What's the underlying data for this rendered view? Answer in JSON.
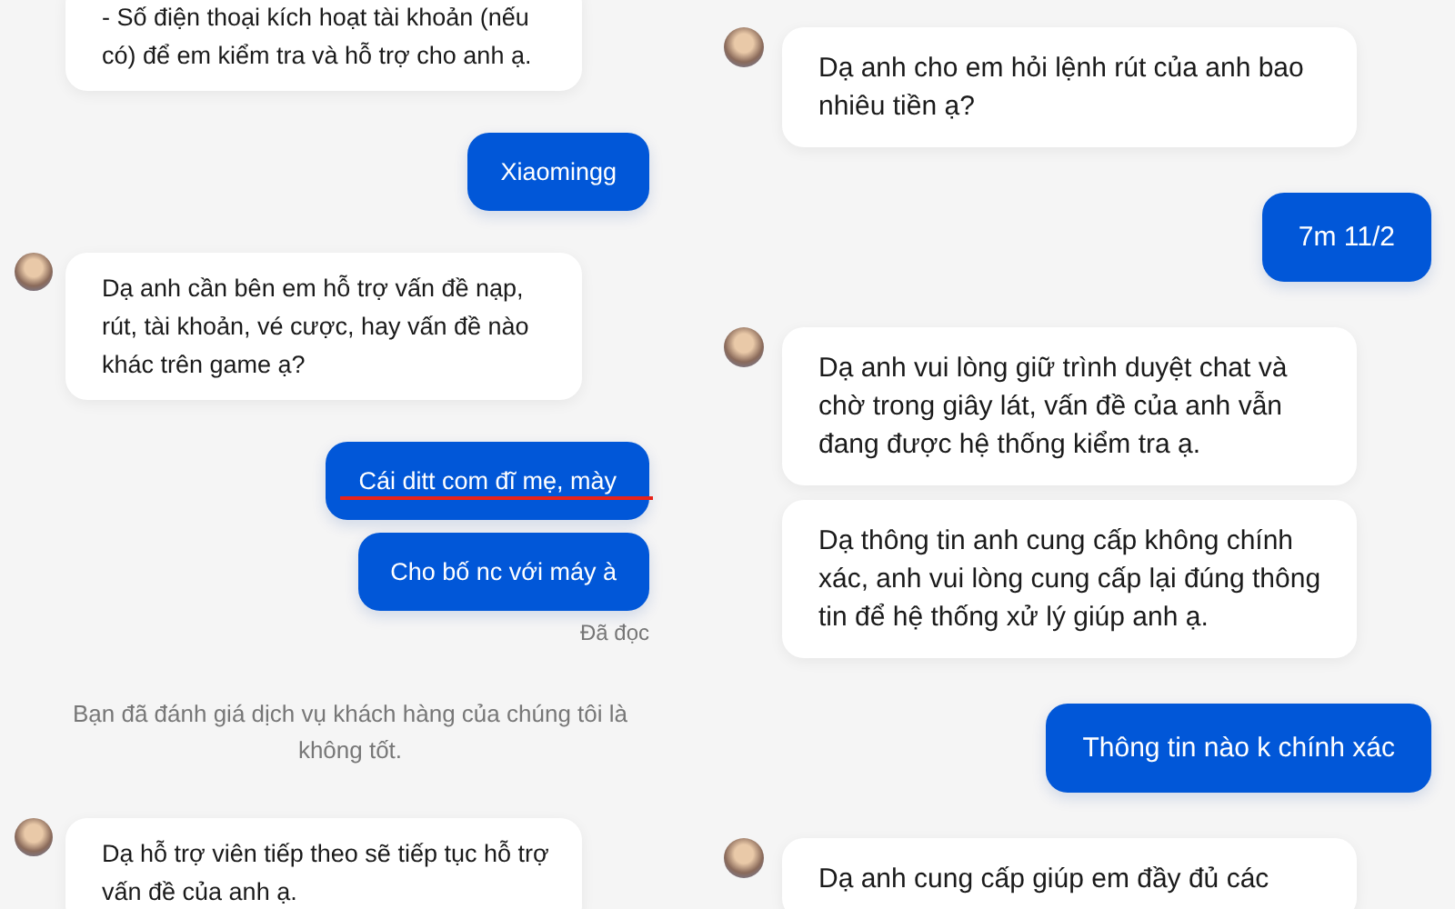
{
  "left_panel": {
    "messages": [
      {
        "kind": "agent",
        "avatar": false,
        "text": "- Số điện thoại kích hoạt tài khoản (nếu có) để em kiểm tra và hỗ trợ cho anh ạ."
      },
      {
        "kind": "user",
        "struck": false,
        "text": "Xiaomingg"
      },
      {
        "kind": "agent",
        "avatar": true,
        "text": "Dạ anh cần bên em hỗ trợ vấn đề nạp, rút, tài khoản, vé cược, hay vấn đề nào khác trên game ạ?"
      },
      {
        "kind": "user",
        "struck": true,
        "text": "Cái ditt com đĩ mẹ, mày"
      },
      {
        "kind": "user",
        "struck": false,
        "text": "Cho bố nc với máy à"
      },
      {
        "kind": "receipt",
        "text": "Đã đọc"
      },
      {
        "kind": "notice",
        "text": "Bạn đã đánh giá dịch vụ khách hàng của chúng tôi là không tốt."
      },
      {
        "kind": "agent",
        "avatar": true,
        "text": "Dạ hỗ trợ viên tiếp theo sẽ tiếp tục hỗ trợ vấn đề của anh ạ."
      }
    ]
  },
  "right_panel": {
    "messages": [
      {
        "kind": "agent",
        "avatar": true,
        "text": "Dạ anh cho em hỏi lệnh rút của anh bao nhiêu tiền ạ?"
      },
      {
        "kind": "user",
        "struck": false,
        "text": "7m 11/2"
      },
      {
        "kind": "agent",
        "avatar": true,
        "text": "Dạ anh vui lòng giữ trình duyệt chat và chờ trong giây lát, vấn đề của anh vẫn đang được hệ thống kiểm tra ạ."
      },
      {
        "kind": "agent",
        "avatar": false,
        "text": "Dạ thông tin anh cung cấp không chính xác, anh vui lòng cung cấp lại đúng thông tin để hệ thống xử lý giúp anh ạ."
      },
      {
        "kind": "user",
        "struck": false,
        "text": "Thông tin nào k chính xác"
      },
      {
        "kind": "agent",
        "avatar": true,
        "text": "Dạ anh cung cấp giúp em đầy đủ các"
      }
    ]
  }
}
